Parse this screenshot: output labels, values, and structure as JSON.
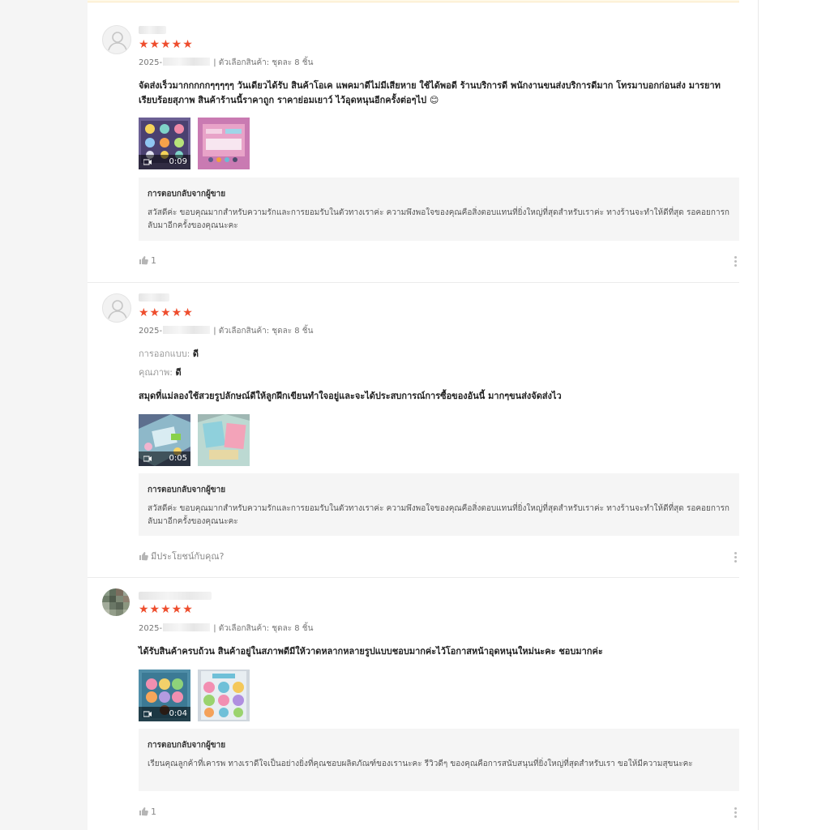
{
  "reviews": [
    {
      "stars": "★★★★★",
      "date_prefix": "2025-",
      "variation": "| ตัวเลือกสินค้า: ชุดละ 8 ชิ้น",
      "text": "จัดส่งเร็วมากกกกกๆๆๆๆๆ วันเดียวได้รับ สินค้าโอเค แพคมาดีไม่มีเสียหาย ใช้ได้พอดี ร้านบริการดี พนักงานขนส่งบริการดีมาก โทรมาบอกก่อนส่ง มารยาทเรียบร้อยสุภาพ สินค้าร้านนี้ราคาถูก ราคาย่อมเยาว์ ไว้อุดหนุนอีกครั้งต่อๆไป 😊",
      "video_duration": "0:09",
      "reply_title": "การตอบกลับจากผู้ขาย",
      "reply_body": "สวัสดีค่ะ ขอบคุณมากสำหรับความรักและการยอมรับในตัวทางเราค่ะ ความพึงพอใจของคุณคือสิ่งตอบแทนที่ยิ่งใหญ่ที่สุดสำหรับเราค่ะ ทางร้านจะทำให้ดีที่สุด รอคอยการกลับมาอีกครั้งของคุณนะคะ",
      "like_label": "1"
    },
    {
      "stars": "★★★★★",
      "date_prefix": "2025-",
      "variation": "| ตัวเลือกสินค้า: ชุดละ 8 ชิ้น",
      "attr1_label": "การออกแบบ:",
      "attr1_value": "ดี",
      "attr2_label": "คุณภาพ:",
      "attr2_value": "ดี",
      "text": "สมุดที่แม่ลองใช้สวยรูปลักษณ์ดีให้ลูกฝึกเขียนทำใจอยู่และจะได้ประสบการณ์การซื้อของอันนี้ มากๆขนส่งจัดส่งไว",
      "video_duration": "0:05",
      "reply_title": "การตอบกลับจากผู้ขาย",
      "reply_body": "สวัสดีค่ะ ขอบคุณมากสำหรับความรักและการยอมรับในตัวทางเราค่ะ ความพึงพอใจของคุณคือสิ่งตอบแทนที่ยิ่งใหญ่ที่สุดสำหรับเราค่ะ ทางร้านจะทำให้ดีที่สุด รอคอยการกลับมาอีกครั้งของคุณนะคะ",
      "like_label": "มีประโยชน์กับคุณ?"
    },
    {
      "stars": "★★★★★",
      "date_prefix": "2025-",
      "variation": "| ตัวเลือกสินค้า: ชุดละ 8 ชิ้น",
      "text": "ได้รับสินค้าครบถ้วน สินค้าอยู่ในสภาพดีมีให้วาดหลากหลายรูปแบบชอบมากค่ะไว้โอกาสหน้าอุดหนุนใหม่นะคะ ชอบมากค่ะ",
      "video_duration": "0:04",
      "reply_title": "การตอบกลับจากผู้ขาย",
      "reply_body": "เรียนคุณลูกค้าที่เคารพ ทางเราดีใจเป็นอย่างยิ่งที่คุณชอบผลิตภัณฑ์ของเรานะคะ รีวิวดีๆ ของคุณคือการสนับสนุนที่ยิ่งใหญ่ที่สุดสำหรับเรา ขอให้มีความสุขนะคะ",
      "like_label": "1"
    }
  ],
  "colors": {
    "star": "#ee4d2d",
    "reply_bg": "#f5f5f5"
  },
  "icons": [
    "user-placeholder-icon",
    "video-camera-icon",
    "thumbs-up-icon",
    "more-vertical-icon"
  ]
}
